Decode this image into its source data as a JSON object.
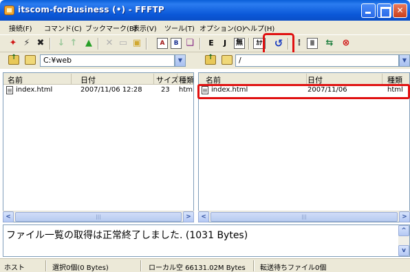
{
  "window": {
    "title": "itscom-forBusiness (•) - FFFTP"
  },
  "menu": [
    "接続(F)",
    "コマンド(C)",
    "ブックマーク(B)",
    "表示(V)",
    "ツール(T)",
    "オプション(O)",
    "ヘルプ(H)"
  ],
  "toolbar": {
    "icons": [
      "connect-icon",
      "disconnect-icon",
      "quick-connect-icon",
      "download-icon",
      "upload-icon",
      "mirror-upload-icon",
      "delete-icon",
      "rename-icon",
      "mkdir-icon",
      "ascii-mode-icon",
      "binary-mode-icon",
      "auto-mode-icon",
      "euc-icon",
      "jis-icon",
      "no-convert-icon",
      "kana-icon",
      "refresh-icon",
      "list-view-icon",
      "detail-view-icon",
      "sync-icon",
      "stop-icon"
    ],
    "labels": {
      "ascii": "A",
      "binary": "B",
      "euc": "E",
      "jis": "J",
      "none": "無",
      "kana": "ｶﾅ"
    }
  },
  "local": {
    "path": "C:¥web",
    "columns": [
      "名前",
      "日付",
      "サイズ",
      "種類"
    ],
    "files": [
      {
        "name": "index.html",
        "date": "2007/11/06 12:28",
        "size": "23",
        "type": "html"
      }
    ]
  },
  "remote": {
    "path": "/",
    "columns": [
      "名前",
      "日付",
      "種類"
    ],
    "files": [
      {
        "name": "index.html",
        "date": "2007/11/06",
        "type": "html"
      }
    ]
  },
  "log": {
    "message": "ファイル一覧の取得は正常終了しました. (1031 Bytes)"
  },
  "status": {
    "host": "ホスト",
    "selection": "選択0個(0 Bytes)",
    "local_free": "ローカル空 66131.02M Bytes",
    "queue": "転送待ちファイル0個"
  },
  "colors": {
    "highlight": "#e01010",
    "titlebar": "#0a5fd8",
    "chrome": "#ece9d8"
  }
}
